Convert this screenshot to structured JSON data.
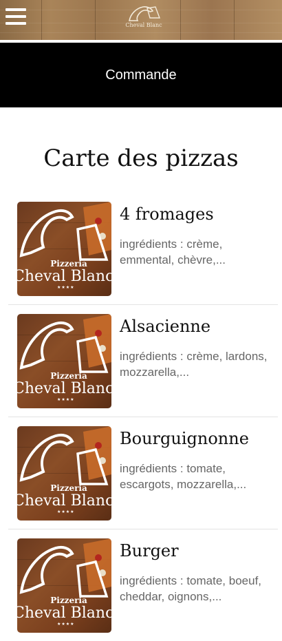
{
  "header": {
    "menu_icon": "hamburger-icon",
    "logo_text": "Cheval Blanc",
    "logo_icon": "horse-logo-icon"
  },
  "page": {
    "title": "Commande",
    "heading": "Carte des pizzas"
  },
  "thumbnail": {
    "brand_line1": "Pizzeria",
    "brand_line2": "Cheval Blanc",
    "stars": "★★★★"
  },
  "pizzas": [
    {
      "name": "4 fromages",
      "description": "ingrédients : crème, emmental, chèvre,..."
    },
    {
      "name": "Alsacienne",
      "description": "ingrédients : crème, lardons, mozzarella,..."
    },
    {
      "name": "Bourguignonne",
      "description": "ingrédients : tomate, escargots, mozzarella,..."
    },
    {
      "name": "Burger",
      "description": "ingrédients : tomate, boeuf, cheddar, oignons,..."
    }
  ],
  "colors": {
    "title_bar": "#000000",
    "background": "#ffffff",
    "text_dark": "#111111",
    "text_muted": "#666666"
  }
}
